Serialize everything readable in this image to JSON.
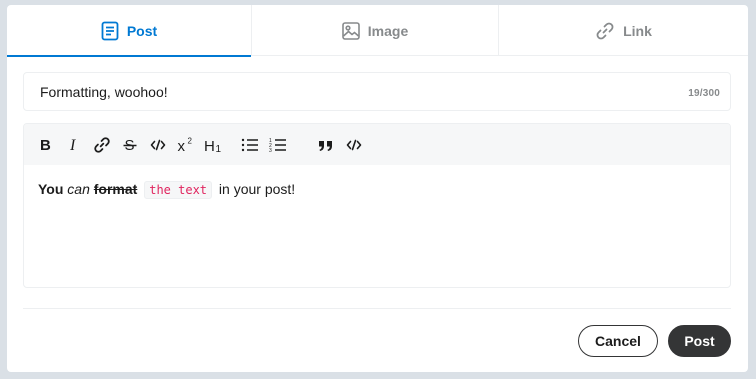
{
  "tabs": [
    {
      "label": "Post",
      "icon": "post-icon",
      "active": true
    },
    {
      "label": "Image",
      "icon": "image-icon",
      "active": false
    },
    {
      "label": "Link",
      "icon": "link-icon",
      "active": false
    }
  ],
  "title_field": {
    "value": "Formatting, woohoo!",
    "char_count": "19/300"
  },
  "toolbar": {
    "buttons": [
      "bold-icon",
      "italic-icon",
      "link-icon",
      "strikethrough-icon",
      "inline-code-icon",
      "superscript-icon",
      "heading-icon",
      "bulleted-list-icon",
      "numbered-list-icon",
      "quote-block-icon",
      "code-block-icon"
    ]
  },
  "body": {
    "bold": "You",
    "italic": "can",
    "strike": "format",
    "code": "the text",
    "rest": "in your post!"
  },
  "actions": {
    "cancel_label": "Cancel",
    "post_label": "Post"
  },
  "colors": {
    "accent": "#0079d3",
    "dark_button": "#343536",
    "code_text": "#e0245e",
    "background": "#dae0e6"
  }
}
